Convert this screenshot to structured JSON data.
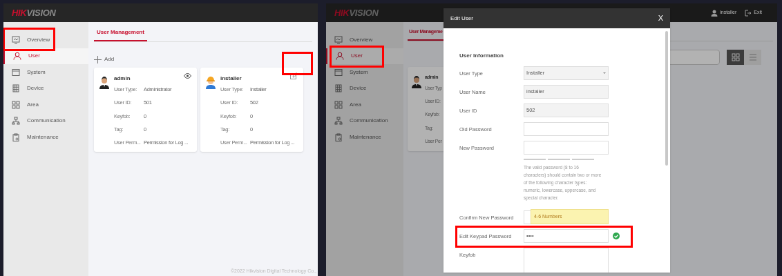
{
  "left_screen": {
    "logo": {
      "accent": "HIK",
      "rest": "VISION"
    },
    "sidebar": [
      {
        "kind": "monitor",
        "label": "Overview",
        "selected": false
      },
      {
        "kind": "person",
        "label": "User",
        "selected": true
      },
      {
        "kind": "window",
        "label": "System",
        "selected": false
      },
      {
        "kind": "device",
        "label": "Device",
        "selected": false
      },
      {
        "kind": "area",
        "label": "Area",
        "selected": false
      },
      {
        "kind": "network",
        "label": "Communication",
        "selected": false
      },
      {
        "kind": "clipboard",
        "label": "Maintenance",
        "selected": false
      }
    ],
    "tabs": [
      {
        "label": "User Management",
        "selected": true
      }
    ],
    "add_button": {
      "label": "Add"
    },
    "user_cards": [
      {
        "name": "admin",
        "kind": "admin",
        "action": {
          "kind": "view"
        },
        "fields": [
          {
            "label": "User Type:",
            "value": "Administrator"
          },
          {
            "label": "User ID:",
            "value": "501"
          },
          {
            "label": "Keyfob:",
            "value": "0"
          },
          {
            "label": "Tag:",
            "value": "0"
          },
          {
            "label": "User Perm...",
            "value": "Permission for Log ..."
          }
        ]
      },
      {
        "name": "installer",
        "kind": "installer",
        "action": {
          "kind": "edit"
        },
        "fields": [
          {
            "label": "User Type:",
            "value": "Installer"
          },
          {
            "label": "User ID:",
            "value": "502"
          },
          {
            "label": "Keyfob:",
            "value": "0"
          },
          {
            "label": "Tag:",
            "value": "0"
          },
          {
            "label": "User Perm...",
            "value": "Permission for Log ..."
          }
        ]
      }
    ],
    "footer": "©2022 Hikvision Digital Technology Co.,"
  },
  "right_screen": {
    "logo": {
      "accent": "HIK",
      "rest": "VISION"
    },
    "user_menu": {
      "user": "installer",
      "exit": "Exit"
    },
    "sidebar": [
      {
        "kind": "monitor",
        "label": "Overview",
        "selected": false
      },
      {
        "kind": "person",
        "label": "User",
        "selected": true
      },
      {
        "kind": "window",
        "label": "System",
        "selected": false
      },
      {
        "kind": "device",
        "label": "Device",
        "selected": false
      },
      {
        "kind": "area",
        "label": "Area",
        "selected": false
      },
      {
        "kind": "network",
        "label": "Communication",
        "selected": false
      },
      {
        "kind": "clipboard",
        "label": "Maintenance",
        "selected": false
      }
    ],
    "tabs": [
      {
        "label": "User Manageme",
        "selected": true
      }
    ],
    "user_cards": [
      {
        "name": "admin",
        "kind": "admin",
        "fields": [
          {
            "label": "User Typ"
          },
          {
            "label": "User ID:"
          },
          {
            "label": "Keyfob:"
          },
          {
            "label": "Tag:"
          },
          {
            "label": "User Per"
          }
        ]
      }
    ],
    "view_toggle": [
      {
        "kind": "grid",
        "selected": true
      },
      {
        "kind": "list",
        "selected": false
      }
    ],
    "dialog": {
      "title": "Edit User",
      "close": "X",
      "section": "User Information",
      "fields": [
        {
          "kind": "select",
          "label": "User Type",
          "value": "Installer",
          "disabled": true
        },
        {
          "kind": "text",
          "label": "User Name",
          "value": "installer",
          "disabled": true
        },
        {
          "kind": "text",
          "label": "User ID",
          "value": "502",
          "disabled": true
        },
        {
          "kind": "password",
          "label": "Old Password",
          "disabled": false
        },
        {
          "kind": "password",
          "label": "New Password",
          "disabled": false,
          "hint": "The valid password (8 to 16 characters) should contain two or more of the following character types: numeric, lowercase, uppercase, and special character."
        },
        {
          "kind": "password",
          "label": "Confirm New Password",
          "disabled": false
        },
        {
          "kind": "password",
          "label": "Edit Keypad Password",
          "value": "••••",
          "disabled": false,
          "valid": true,
          "tooltip": "4-6 Numbers"
        },
        {
          "kind": "textarea",
          "label": "Keyfob",
          "disabled": false
        }
      ]
    }
  }
}
